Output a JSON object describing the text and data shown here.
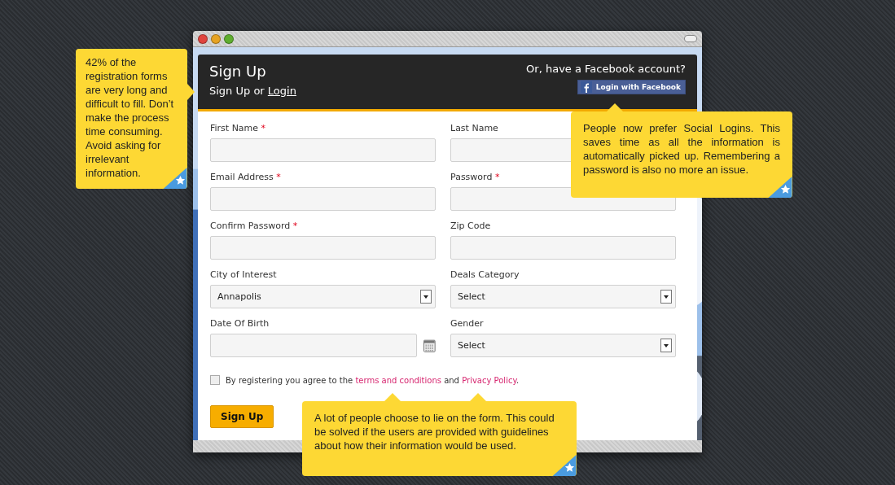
{
  "window": {
    "header": {
      "title": "Sign Up",
      "subtitle_text": "Sign Up or",
      "login_link": "Login",
      "facebook_prompt": "Or, have a Facebook account?",
      "facebook_button": "Login with Facebook"
    }
  },
  "form": {
    "rows": [
      {
        "fields": [
          {
            "label": "First Name",
            "required": true,
            "kind": "text"
          },
          {
            "label": "Last Name",
            "required": false,
            "kind": "text"
          }
        ]
      },
      {
        "fields": [
          {
            "label": "Email Address",
            "required": true,
            "kind": "text"
          },
          {
            "label": "Password",
            "required": true,
            "kind": "text"
          }
        ]
      },
      {
        "fields": [
          {
            "label": "Confirm Password",
            "required": true,
            "kind": "text"
          },
          {
            "label": "Zip Code",
            "required": false,
            "kind": "text"
          }
        ]
      },
      {
        "fields": [
          {
            "label": "City of Interest",
            "required": false,
            "kind": "select",
            "value": "Annapolis"
          },
          {
            "label": "Deals Category",
            "required": false,
            "kind": "select",
            "value": "Select"
          }
        ]
      },
      {
        "fields": [
          {
            "label": "Date Of Birth",
            "required": false,
            "kind": "date"
          },
          {
            "label": "Gender",
            "required": false,
            "kind": "select",
            "value": "Select"
          }
        ]
      }
    ],
    "required_mark": "*",
    "consent": {
      "checked": false,
      "text_before": "By registering you agree to the",
      "terms_link": "terms and conditions",
      "text_middle": "and",
      "privacy_link": "Privacy Policy",
      "text_end": "."
    },
    "submit": "Sign Up"
  },
  "notes": [
    {
      "text": "42% of the registration forms are very long and difficult to fill. Don’t make the process time consuming. Avoid asking for irrelevant information."
    },
    {
      "text": "People now prefer Social Logins. This saves time as all the information is automatically picked up. Remembering a password is also no more an issue."
    },
    {
      "text": "A lot of people choose to lie on the form. This could be solved if the users are provided with guidelines about how their information would be used."
    }
  ]
}
